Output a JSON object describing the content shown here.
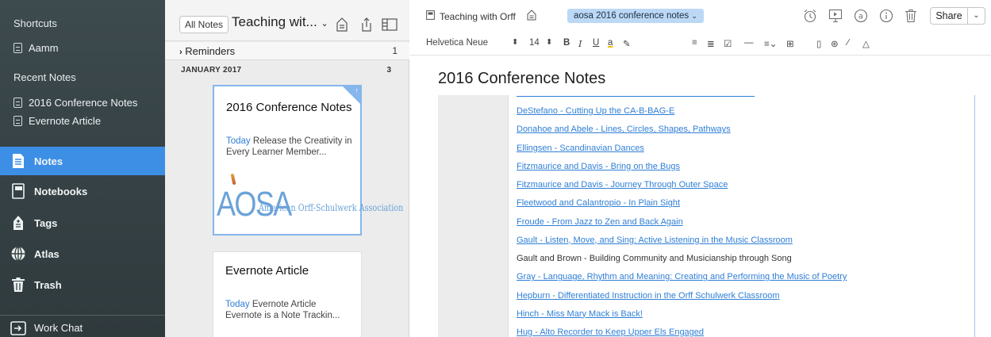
{
  "sidebar": {
    "shortcuts_heading": "Shortcuts",
    "shortcuts": [
      {
        "label": "Aamm"
      }
    ],
    "recent_heading": "Recent Notes",
    "recent": [
      {
        "label": "2016 Conference Notes"
      },
      {
        "label": "Evernote Article"
      }
    ],
    "nav": [
      {
        "label": "Notes",
        "icon": "notes-icon",
        "active": true
      },
      {
        "label": "Notebooks",
        "icon": "notebook-icon",
        "active": false
      },
      {
        "label": "Tags",
        "icon": "tag-icon",
        "active": false
      },
      {
        "label": "Atlas",
        "icon": "globe-icon",
        "active": false
      },
      {
        "label": "Trash",
        "icon": "trash-icon",
        "active": false
      }
    ],
    "work_chat": "Work Chat"
  },
  "note_list": {
    "all_notes_button": "All Notes",
    "notebook_title": "Teaching wit...",
    "reminders_label": "Reminders",
    "reminders_count": "1",
    "month_label": "JANUARY 2017",
    "month_count": "3",
    "cards": [
      {
        "title": "2016 Conference Notes",
        "date": "Today",
        "snippet": "Release the Creativity in Every Learner Member...",
        "logo_big": "AOSA",
        "logo_small": "American Orff-Schulwerk Association"
      },
      {
        "title": "Evernote Article",
        "date": "Today",
        "snippet": "Evernote Article Evernote is a Note Trackin..."
      }
    ]
  },
  "editor": {
    "notebook": "Teaching with Orff",
    "tag": "aosa 2016 conference notes",
    "share_label": "Share",
    "font_name": "Helvetica Neue",
    "font_size": "14",
    "title": "2016 Conference Notes",
    "entries": [
      {
        "text": "DeStefano - Cutting Up the CA-B-BAG-E",
        "link": true
      },
      {
        "text": "Donahoe and Abele - Lines, Circles, Shapes, Pathways",
        "link": true
      },
      {
        "text": "Ellingsen - Scandinavian Dances",
        "link": true
      },
      {
        "text": "Fitzmaurice and Davis - Bring on the Bugs",
        "link": true
      },
      {
        "text": "Fitzmaurice and Davis - Journey Through Outer Space",
        "link": true
      },
      {
        "text": "Fleetwood and Calantropio - In Plain Sight",
        "link": true
      },
      {
        "text": "Froude - From Jazz to Zen and Back Again",
        "link": true
      },
      {
        "text": "Gault - Listen, Move, and Sing: Active Listening in the Music Classroom",
        "link": true
      },
      {
        "text": "Gault and Brown - Building Community and Musicianship through Song",
        "link": false
      },
      {
        "text": "Gray - Language, Rhythm and Meaning: Creating and Performing the Music of Poetry",
        "link": true
      },
      {
        "text": "Hepburn - Differentiated Instruction in the Orff Schulwerk Classroom",
        "link": true
      },
      {
        "text": "Hinch - Miss Mary Mack is Back!",
        "link": true
      },
      {
        "text": "Hug - Alto Recorder to Keep Upper Els Engaged",
        "link": true
      }
    ]
  },
  "colors": {
    "sidebar_bg": "#35413f",
    "active_nav": "#3d8fe6",
    "link": "#2f7fd6",
    "tag_pill": "#bcd8f5"
  }
}
